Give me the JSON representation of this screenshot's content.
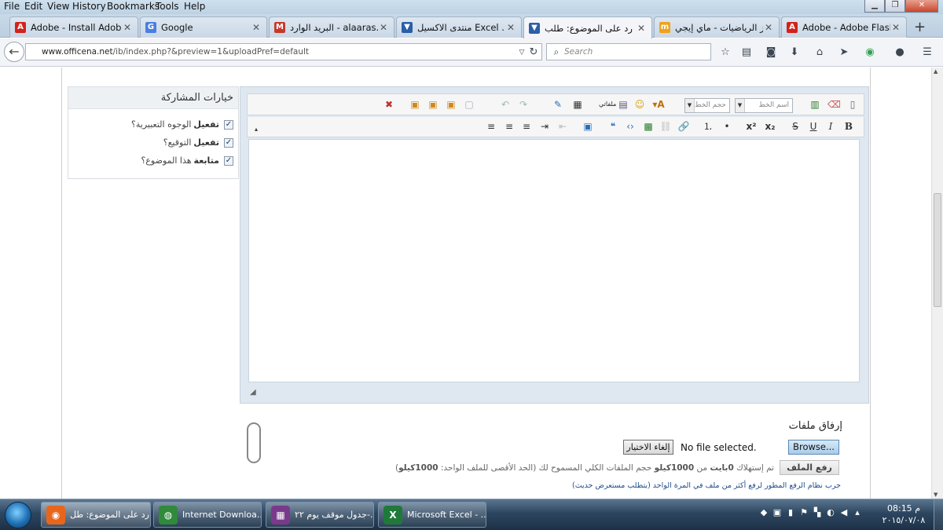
{
  "menu": [
    "File",
    "Edit",
    "View",
    "History",
    "Bookmarks",
    "Tools",
    "Help"
  ],
  "tabs": [
    {
      "title": "Adobe - Install Adobe ...",
      "icon": "adobe-icon",
      "color": "#d1231c"
    },
    {
      "title": "Google",
      "icon": "google-icon",
      "color": "#4a7fe0"
    },
    {
      "title": "البريد الوارد - alaaras...",
      "icon": "gmail-icon",
      "color": "#c5392b"
    },
    {
      "title": "منتدى الاكسيل Excel ...",
      "icon": "officena-icon",
      "color": "#2a5ea8"
    },
    {
      "title": "رد على الموضوع: طلب ...",
      "icon": "officena-icon",
      "color": "#2a5ea8"
    },
    {
      "title": "ألغاز الرياضيات - ماي إيجي",
      "icon": "myegy-icon",
      "color": "#f0a21c"
    },
    {
      "title": "Adobe - Adobe Flash ...",
      "icon": "adobe-icon",
      "color": "#d1231c"
    }
  ],
  "url": {
    "domain": "www.officena.net",
    "path": "/ib/index.php?&preview=1&uploadPref=default"
  },
  "search": {
    "placeholder": "Search"
  },
  "share": {
    "title": "خيارات المشاركة",
    "options": [
      {
        "bold": "تفعيل",
        "rest": "الوجوه التعبيرية؟",
        "checked": true
      },
      {
        "bold": "تفعيل",
        "rest": "التوقيع؟",
        "checked": true
      },
      {
        "bold": "متابعة",
        "rest": "هذا الموضوع؟",
        "checked": true
      }
    ]
  },
  "editor": {
    "font_name_placeholder": "اسم الخط",
    "font_size_placeholder": "حجم الخط",
    "my_files": "ملفاتي"
  },
  "attach": {
    "title": "إرفاق ملفات",
    "browse": "Browse...",
    "no_file": "No file selected.",
    "cancel": "إلغاء الاختيار",
    "upload": "رفع الملف",
    "usage_pre": "تم إستهلاك",
    "usage_used": "0بايت",
    "usage_mid": "من",
    "usage_total": "1000كيلو",
    "usage_post": "حجم الملفات الكلي المسموح لك (الحد الأقصى للملف الواحد:",
    "usage_max": "1000كيلو",
    "usage_end": ")",
    "try_advanced": "جرب نظام الرفع المطور لرفع أكثر من ملف في المرة الواحد (يتطلب مستعرض حديث)"
  },
  "taskbar": {
    "tasks": [
      {
        "label": "رد على الموضوع: طل...",
        "icon": "firefox-icon",
        "color": "#e8661c"
      },
      {
        "label": "Internet Downloa...",
        "icon": "idm-icon",
        "color": "#2f8a3c"
      },
      {
        "label": "جدول موقف يوم ٢٢-...",
        "icon": "winrar-icon",
        "color": "#7a3a8c"
      },
      {
        "label": "Microsoft Excel - ...",
        "icon": "excel-icon",
        "color": "#1f7a3a"
      }
    ],
    "time": "08:15 م",
    "date": "٢٠١٥/٠٧/٠٨"
  }
}
